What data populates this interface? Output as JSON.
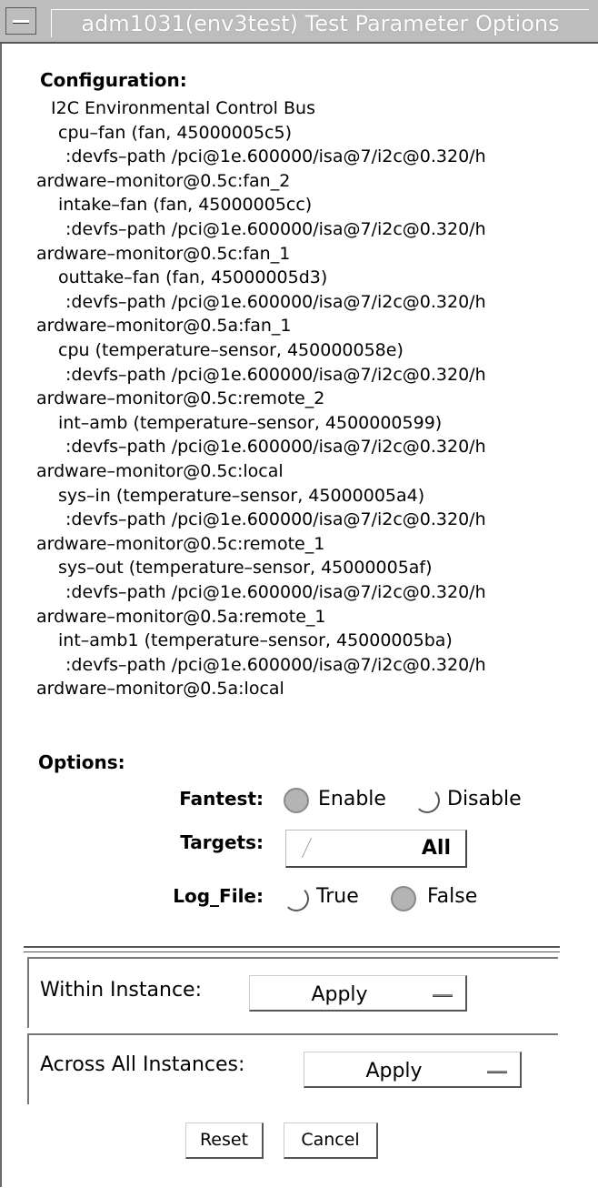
{
  "window": {
    "title": "adm1031(env3test) Test Parameter Options"
  },
  "configuration": {
    "heading": "Configuration:",
    "lines": [
      "  I2C Environmental Control Bus",
      "   cpu–fan (fan, 45000005c5)",
      "    :devfs–path  /pci@1e.600000/isa@7/i2c@0.320/h",
      "ardware–monitor@0.5c:fan_2",
      "   intake–fan (fan, 45000005cc)",
      "    :devfs–path  /pci@1e.600000/isa@7/i2c@0.320/h",
      "ardware–monitor@0.5c:fan_1",
      "   outtake–fan (fan, 45000005d3)",
      "    :devfs–path  /pci@1e.600000/isa@7/i2c@0.320/h",
      "ardware–monitor@0.5a:fan_1",
      "   cpu (temperature–sensor, 450000058e)",
      "    :devfs–path  /pci@1e.600000/isa@7/i2c@0.320/h",
      "ardware–monitor@0.5c:remote_2",
      "   int–amb (temperature–sensor, 4500000599)",
      "    :devfs–path  /pci@1e.600000/isa@7/i2c@0.320/h",
      "ardware–monitor@0.5c:local",
      "   sys–in (temperature–sensor, 45000005a4)",
      "    :devfs–path  /pci@1e.600000/isa@7/i2c@0.320/h",
      "ardware–monitor@0.5c:remote_1",
      "   sys–out (temperature–sensor, 45000005af)",
      "    :devfs–path  /pci@1e.600000/isa@7/i2c@0.320/h",
      "ardware–monitor@0.5a:remote_1",
      "   int–amb1 (temperature–sensor, 45000005ba)",
      "    :devfs–path  /pci@1e.600000/isa@7/i2c@0.320/h",
      "ardware–monitor@0.5a:local"
    ]
  },
  "options": {
    "heading": "Options:",
    "fantest": {
      "label": "Fantest:",
      "enable": "Enable",
      "disable": "Disable",
      "selected": "Enable"
    },
    "targets": {
      "label": "Targets:",
      "value": "All"
    },
    "log_file": {
      "label": "Log_File:",
      "true": "True",
      "false": "False",
      "selected": "False"
    }
  },
  "within_instance": {
    "label": "Within Instance:",
    "value": "Apply"
  },
  "across_instances": {
    "label": "Across All Instances:",
    "value": "Apply"
  },
  "buttons": {
    "reset": "Reset",
    "cancel": "Cancel"
  }
}
